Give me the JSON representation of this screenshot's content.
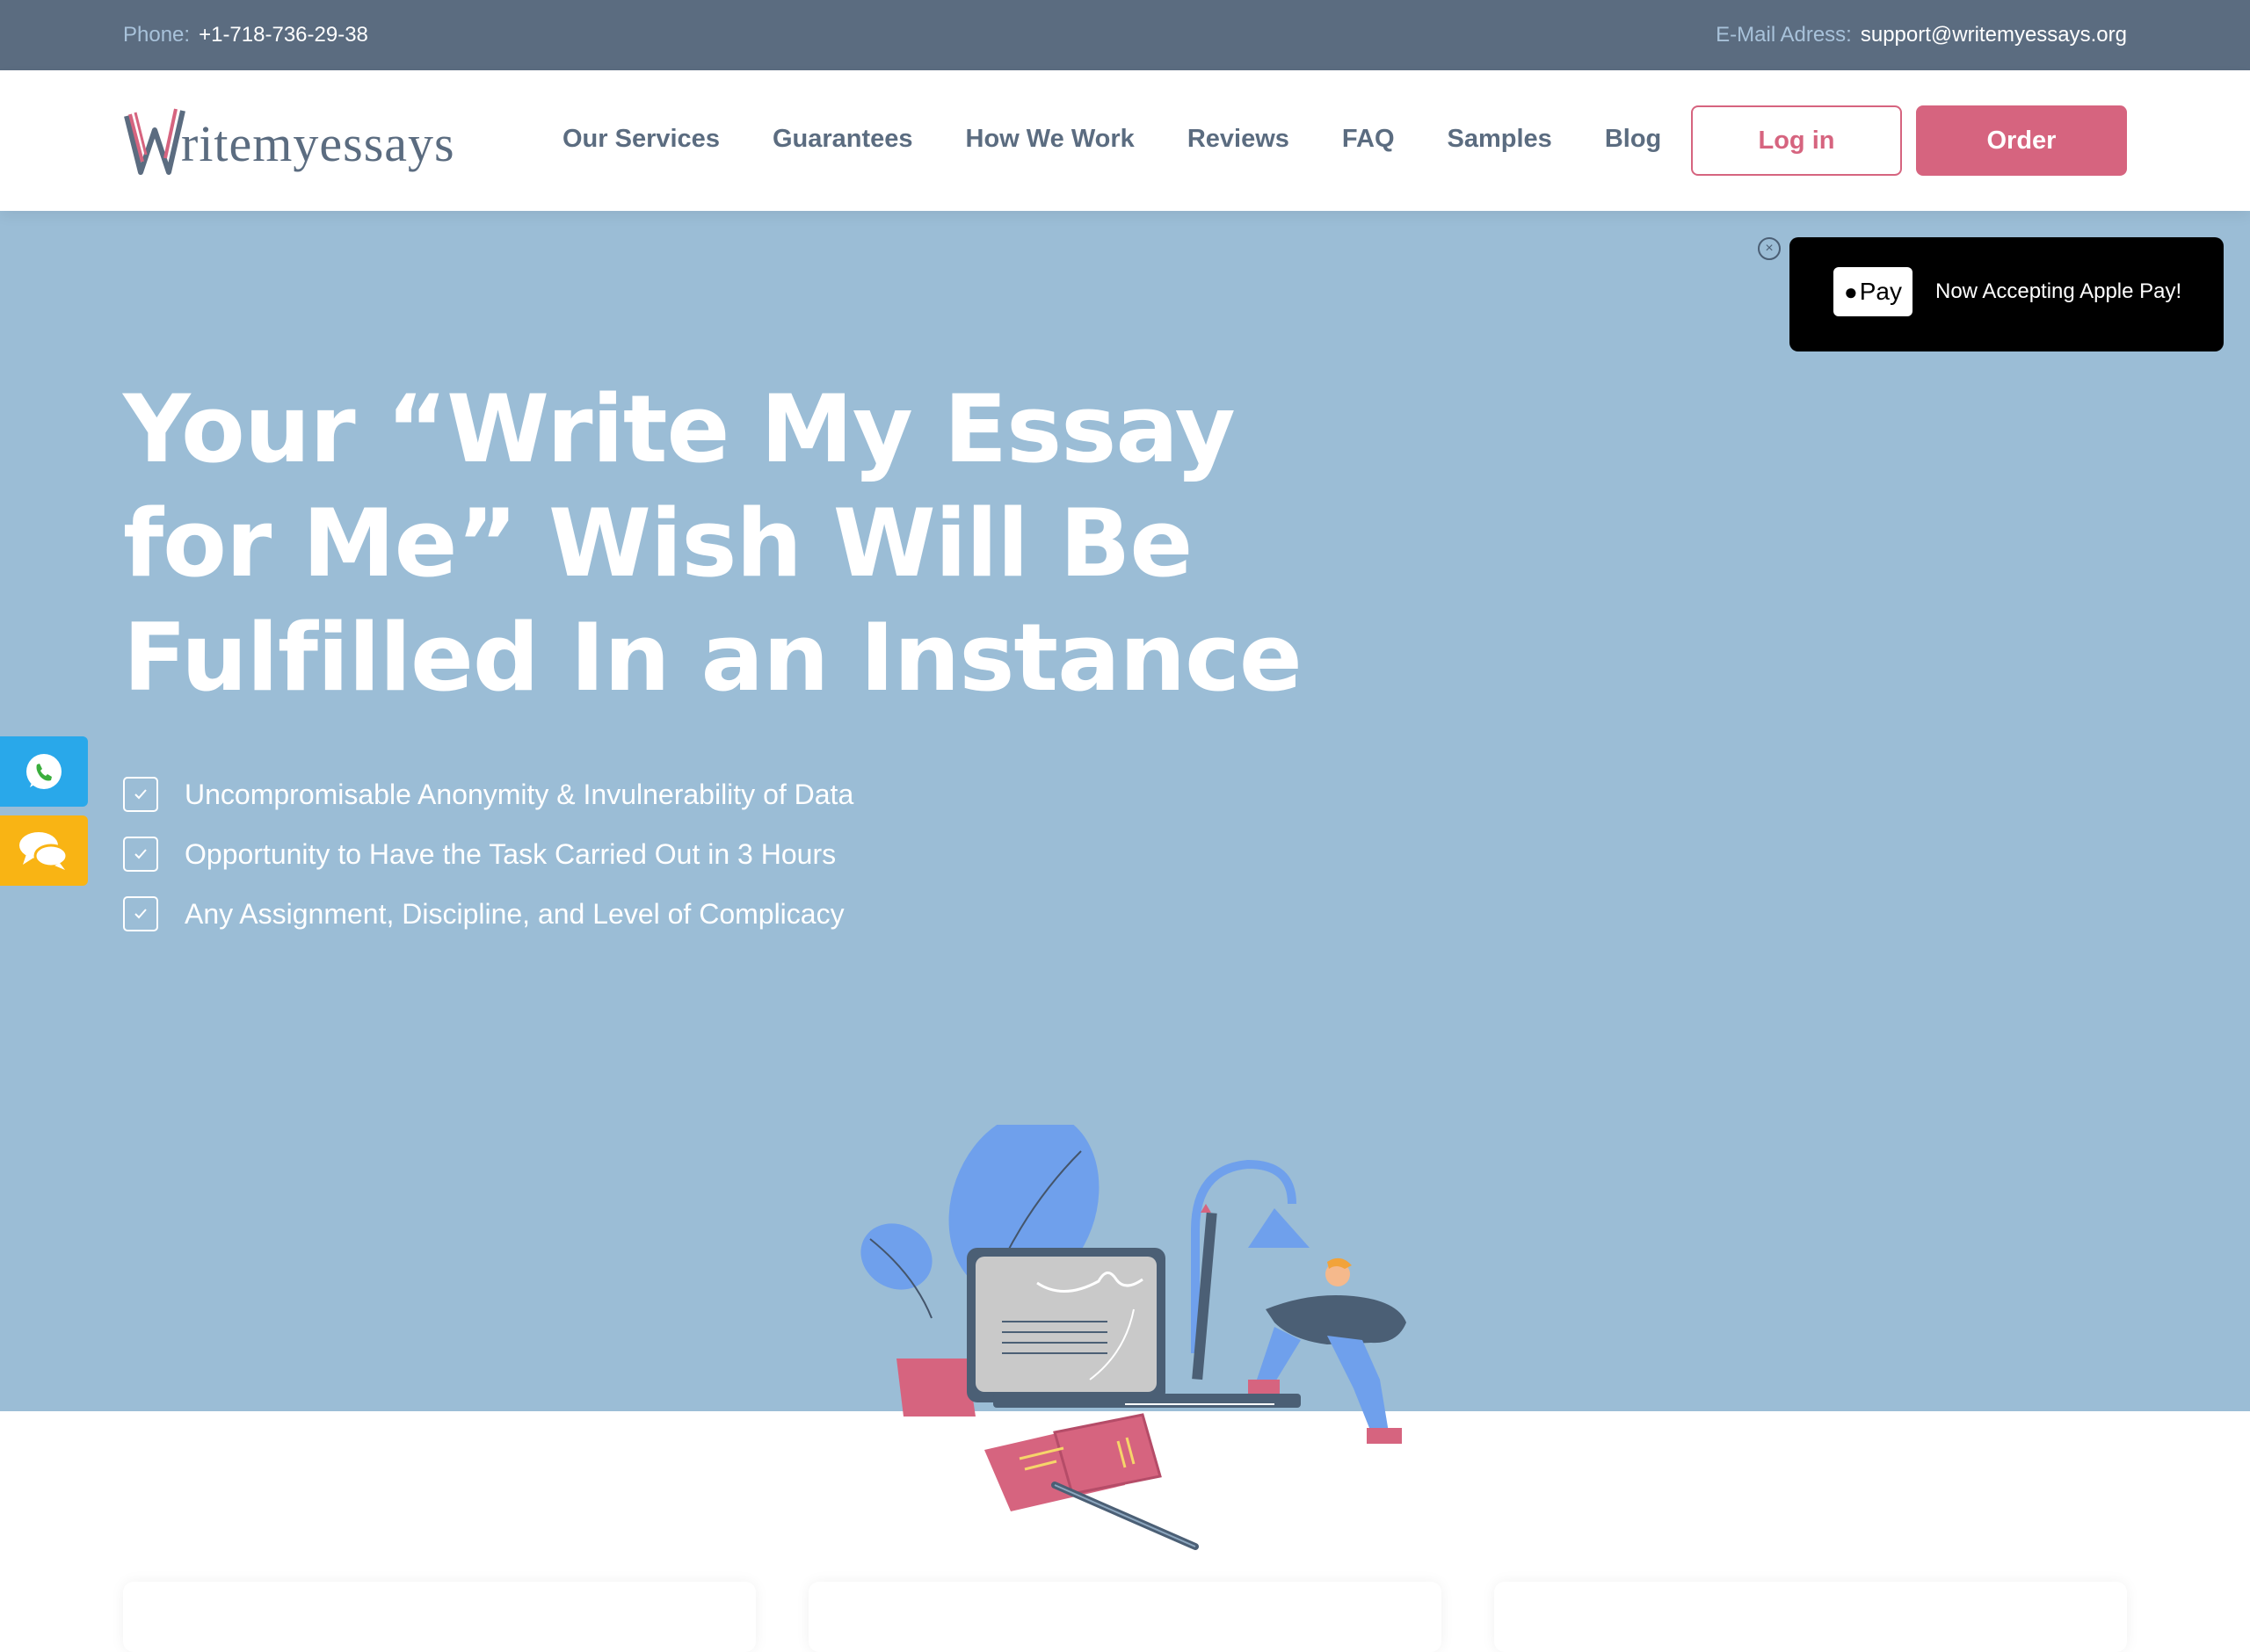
{
  "topbar": {
    "phone_label": "Phone:",
    "phone_value": "+1-718-736-29-38",
    "email_label": "E-Mail Adress:",
    "email_value": "support@writemyessays.org"
  },
  "logo": {
    "text": "ritemyessays",
    "letter": "W"
  },
  "nav": {
    "items": [
      "Our Services",
      "Guarantees",
      "How We Work",
      "Reviews",
      "FAQ",
      "Samples",
      "Blog"
    ],
    "login_label": "Log in",
    "order_label": "Order"
  },
  "hero": {
    "title_lines": [
      "Your “Write My Essay",
      "for Me” Wish Will Be",
      "Fulfilled In an Instance"
    ],
    "features": [
      "Uncompromisable Anonymity & Invulnerability of Data",
      "Opportunity to Have the Task Carried Out in 3 Hours",
      "Any Assignment, Discipline, and Level of Complicacy"
    ]
  },
  "applepay": {
    "badge_text": "Pay",
    "message": "Now Accepting Apple Pay!"
  },
  "icons": {
    "close": "close-icon",
    "whatsapp": "whatsapp-icon",
    "chat": "chat-icon",
    "check": "check-icon"
  },
  "colors": {
    "topbar_bg": "#5b6c80",
    "hero_bg": "#9bbdd6",
    "accent": "#d6647f",
    "whatsapp_bg": "#29a8ea",
    "chat_bg": "#f9b414"
  }
}
